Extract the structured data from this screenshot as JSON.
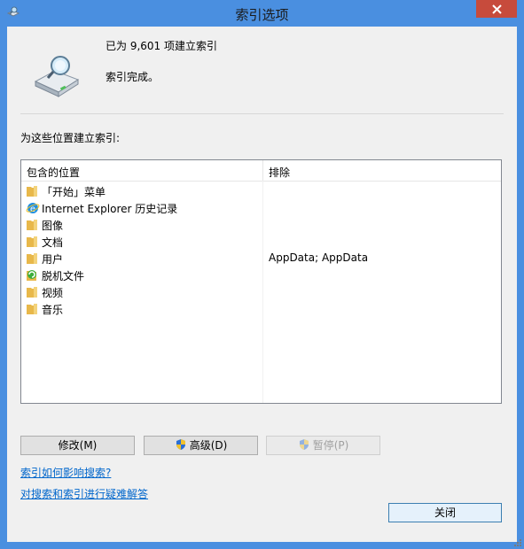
{
  "window": {
    "title": "索引选项",
    "close_label": "x"
  },
  "header": {
    "count_text": "已为 9,601 项建立索引",
    "status_text": "索引完成。"
  },
  "section_label": "为这些位置建立索引:",
  "list": {
    "columns": [
      "包含的位置",
      "排除"
    ],
    "rows": [
      {
        "icon": "folder-icon",
        "name": "「开始」菜单",
        "exclude": ""
      },
      {
        "icon": "internet-explorer-icon",
        "name": "Internet Explorer 历史记录",
        "exclude": ""
      },
      {
        "icon": "folder-icon",
        "name": "图像",
        "exclude": ""
      },
      {
        "icon": "folder-icon",
        "name": "文档",
        "exclude": ""
      },
      {
        "icon": "folder-icon",
        "name": "用户",
        "exclude": "AppData; AppData"
      },
      {
        "icon": "offline-files-icon",
        "name": "脱机文件",
        "exclude": ""
      },
      {
        "icon": "folder-icon",
        "name": "视频",
        "exclude": ""
      },
      {
        "icon": "folder-icon",
        "name": "音乐",
        "exclude": ""
      }
    ]
  },
  "buttons": {
    "modify": "修改(M)",
    "advanced": "高级(D)",
    "pause": "暂停(P)",
    "close": "关闭"
  },
  "links": {
    "how_indexing_affects": "索引如何影响搜索?",
    "troubleshoot": "对搜索和索引进行疑难解答"
  },
  "colors": {
    "titlebar": "#4a8fe0",
    "close_button": "#c74b3c",
    "link": "#0066cc"
  }
}
